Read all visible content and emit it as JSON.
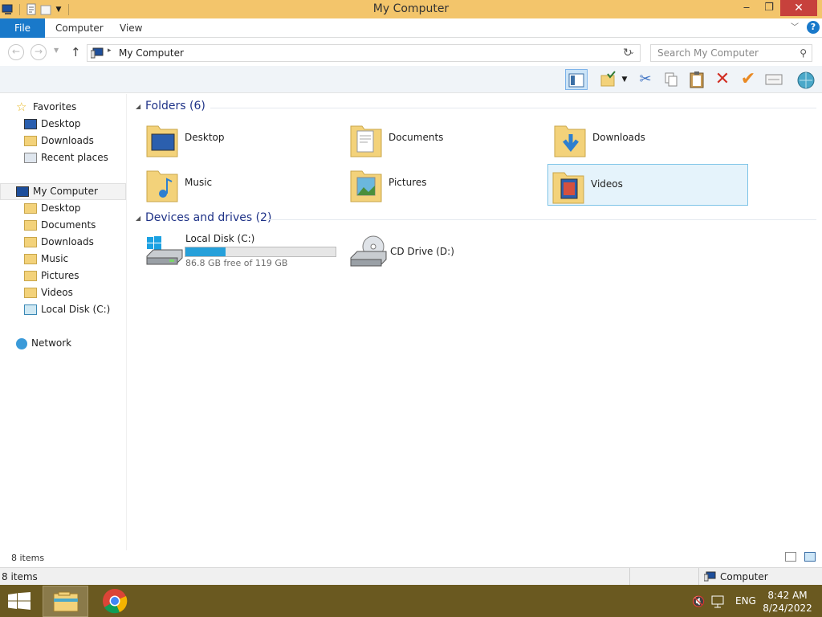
{
  "window": {
    "title": "My Computer"
  },
  "ribbon": {
    "tabs": [
      "File",
      "Computer",
      "View"
    ]
  },
  "address": {
    "path": "My Computer",
    "search_placeholder": "Search My Computer"
  },
  "nav": {
    "favorites": "Favorites",
    "fav_items": [
      "Desktop",
      "Downloads",
      "Recent places"
    ],
    "computer": "My Computer",
    "computer_items": [
      "Desktop",
      "Documents",
      "Downloads",
      "Music",
      "Pictures",
      "Videos",
      "Local Disk (C:)"
    ],
    "network": "Network"
  },
  "content": {
    "folders_header": "Folders (6)",
    "folders": [
      "Desktop",
      "Documents",
      "Downloads",
      "Music",
      "Pictures",
      "Videos"
    ],
    "devices_header": "Devices and drives (2)",
    "local_disk": {
      "name": "Local Disk (C:)",
      "free_text": "86.8 GB free of 119 GB",
      "used_fraction": 0.27
    },
    "cd_drive": {
      "name": "CD Drive (D:)"
    }
  },
  "status": {
    "items": "8 items",
    "items2": "8 items",
    "computer": "Computer"
  },
  "taskbar": {
    "time": "8:42 AM",
    "date": "8/24/2022",
    "lang": "ENG"
  },
  "colors": {
    "title_bar": "#f3c56b",
    "file_tab": "#1979ca",
    "selection": "#e5f3fb",
    "taskbar": "#6a5920",
    "close": "#c7413c"
  }
}
